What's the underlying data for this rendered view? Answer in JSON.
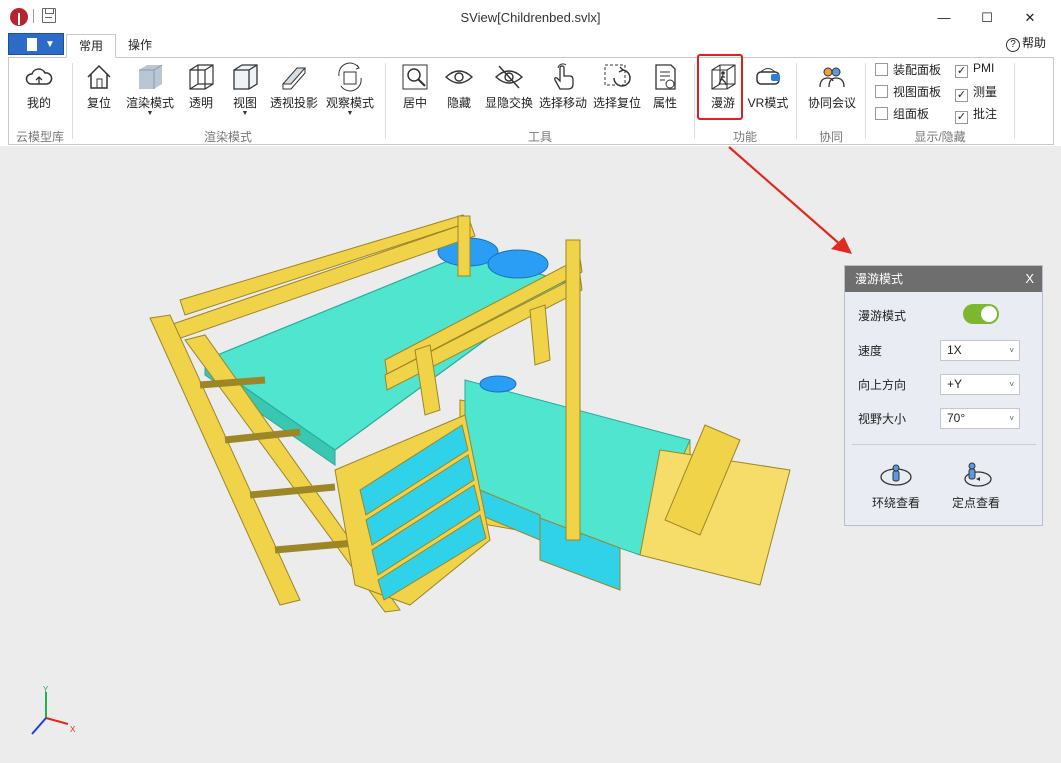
{
  "window": {
    "title": "SView[Childrenbed.svlx]",
    "minimize": "—",
    "maximize": "☐",
    "close": "✕"
  },
  "tabs": [
    {
      "label": "常用",
      "active": true
    },
    {
      "label": "操作",
      "active": false
    }
  ],
  "help_label": "帮助",
  "ribbon": {
    "groups": {
      "cloud": "云模型库",
      "render": "渲染模式",
      "tools": "工具",
      "function": "功能",
      "collab": "协同",
      "display": "显示/隐藏"
    },
    "buttons": {
      "mine": "我的",
      "reset": "复位",
      "render_mode": "渲染模式",
      "transparent": "透明",
      "view": "视图",
      "perspective": "透视投影",
      "observe_mode": "观察模式",
      "center": "居中",
      "hide": "隐藏",
      "toggle_visibility": "显隐交换",
      "select_move": "选择移动",
      "select_reset": "选择复位",
      "properties": "属性",
      "roam": "漫游",
      "vr_mode": "VR模式",
      "meeting": "协同会议"
    },
    "checkboxes": [
      {
        "label": "装配面板",
        "checked": false
      },
      {
        "label": "视图面板",
        "checked": false
      },
      {
        "label": "组面板",
        "checked": false
      },
      {
        "label": "PMI",
        "checked": true
      },
      {
        "label": "测量",
        "checked": true
      },
      {
        "label": "批注",
        "checked": true
      }
    ]
  },
  "roam_panel": {
    "title": "漫游模式",
    "close": "X",
    "mode_label": "漫游模式",
    "mode_enabled": true,
    "speed_label": "速度",
    "speed_value": "1X",
    "up_label": "向上方向",
    "up_value": "+Y",
    "fov_label": "视野大小",
    "fov_value": "70°",
    "orbit_view": "环绕查看",
    "fixed_view": "定点查看"
  },
  "axis": {
    "x": "X",
    "y": "Y"
  },
  "colors": {
    "accent_blue": "#2c6cc7",
    "highlight_red": "#e0201e",
    "toggle_green": "#7cb72f",
    "wood": "#f1d34a",
    "mattress": "#4fe5cf",
    "pillow": "#2a9df5"
  }
}
